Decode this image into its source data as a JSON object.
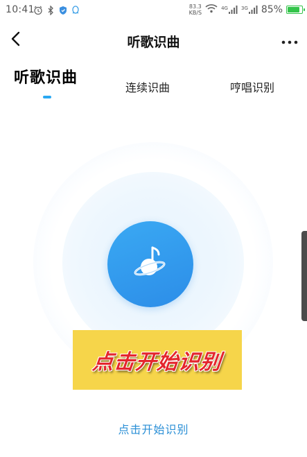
{
  "status_bar": {
    "time": "10:41",
    "net_speed_value": "83.3",
    "net_speed_unit": "KB/S",
    "signal_1_label": "4G",
    "signal_2_label": "3G",
    "battery_text": "85%",
    "battery_level": 0.85,
    "icons": [
      "alarm-icon",
      "bluetooth-icon",
      "shield-icon",
      "qq-icon",
      "wifi-icon",
      "signal-icon",
      "battery-icon"
    ]
  },
  "header": {
    "title": "听歌识曲",
    "back_icon": "back-arrow-icon",
    "more_icon": "more-icon"
  },
  "tabs": [
    {
      "label": "听歌识曲",
      "active": true
    },
    {
      "label": "连续识曲",
      "active": false
    },
    {
      "label": "哼唱识别",
      "active": false
    }
  ],
  "main": {
    "record_icon": "music-planet-icon",
    "banner_text": "点击开始识别",
    "hint_text": "点击开始识别"
  },
  "colors": {
    "accent": "#2aa8f2",
    "button_blue": "#2f95ec",
    "banner_yellow": "#f6d54a",
    "banner_red": "#e4262d",
    "hint_blue": "#2a8fd6",
    "battery_green": "#33c44a"
  }
}
